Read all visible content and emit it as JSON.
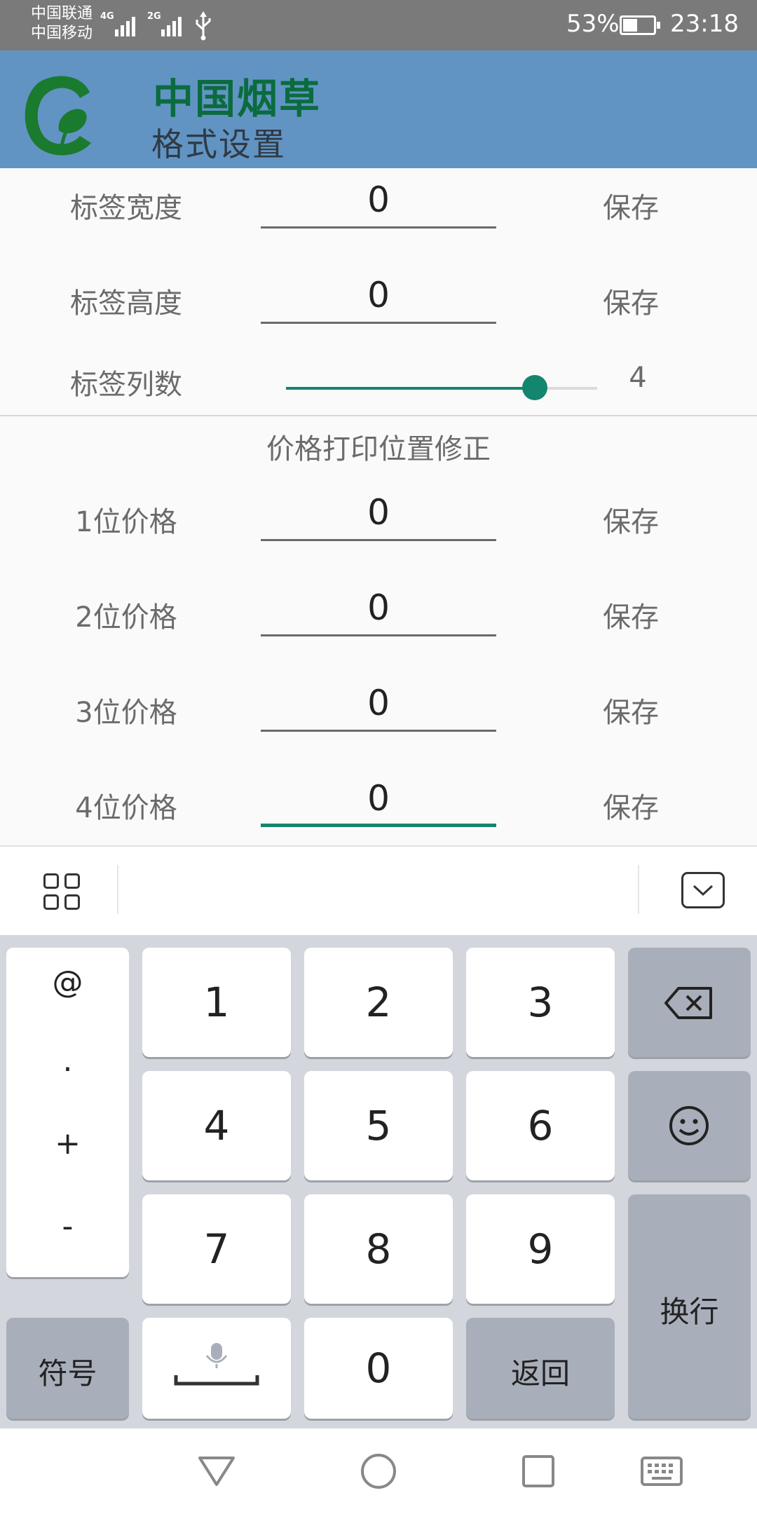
{
  "status": {
    "carrier_1": "中国联通",
    "carrier_2": "中国移动",
    "network_1": "4G",
    "network_2": "2G",
    "battery_percent": "53%",
    "battery_level": 0.53,
    "time": "23:18"
  },
  "header": {
    "title": "中国烟草",
    "subtitle": "格式设置",
    "logo_icon": "tobacco-leaf-logo",
    "title_color": "#0b6b3e",
    "background": "#6194c3"
  },
  "label_settings": [
    {
      "label": "标签宽度",
      "value": "0",
      "action": "保存"
    },
    {
      "label": "标签高度",
      "value": "0",
      "action": "保存"
    }
  ],
  "columns": {
    "label": "标签列数",
    "value": "4",
    "fraction": 0.8,
    "accent": "#14856f"
  },
  "price_section": {
    "title": "价格打印位置修正",
    "rows": [
      {
        "label": "1位价格",
        "value": "0",
        "action": "保存"
      },
      {
        "label": "2位价格",
        "value": "0",
        "action": "保存"
      },
      {
        "label": "3位价格",
        "value": "0",
        "action": "保存"
      },
      {
        "label": "4位价格",
        "value": "0",
        "action": "保存"
      }
    ]
  },
  "keyboard": {
    "toolbar_icons": [
      "grid-menu-icon",
      "keyboard-hide-icon"
    ],
    "symbols": [
      "@",
      ".",
      "+",
      "-"
    ],
    "digits": [
      "1",
      "2",
      "3",
      "4",
      "5",
      "6",
      "7",
      "8",
      "9",
      "0"
    ],
    "symbol_key": "符号",
    "back_key": "返回",
    "enter_key": "换行",
    "icons": [
      "backspace-icon",
      "emoji-icon",
      "microphone-space-icon"
    ]
  },
  "navigation": [
    "back-icon",
    "home-icon",
    "recents-icon",
    "keyboard-switch-icon"
  ]
}
